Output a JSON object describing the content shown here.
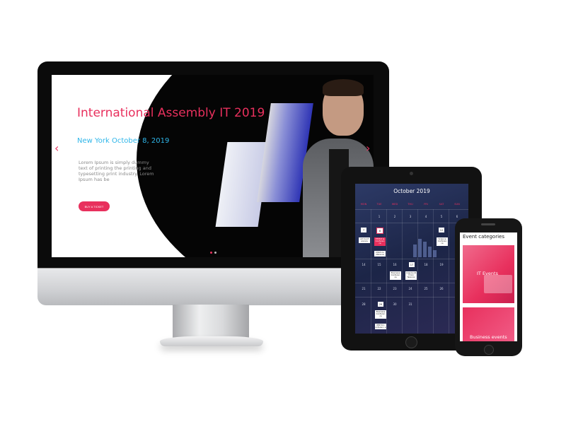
{
  "desktop": {
    "hero": {
      "title": "International Assembly IT 2019",
      "subtitle": "New York October 8, 2019",
      "body": "Lorem Ipsum is simply dummy text of printing the printing and typesetting print industry. Lorem Ipsum has be",
      "button_label": "BUY A TICKET",
      "prev_arrow": "‹",
      "next_arrow": "›"
    }
  },
  "tablet": {
    "calendar": {
      "title": "October 2019",
      "weekdays": [
        "MON",
        "TUE",
        "WED",
        "THU",
        "FRI",
        "SAT",
        "SUN"
      ],
      "week1": [
        "1",
        "2",
        "3",
        "4",
        "5",
        "6"
      ],
      "week2_badges": [
        "7",
        "8",
        "12"
      ],
      "week2_events": [
        "Art Conf erence",
        "HTML5 & Conferen ce",
        "Science Conferen ce"
      ],
      "week2_event_extra": "CSS3 Co nference",
      "week3": [
        "14",
        "15",
        "16",
        "17",
        "18",
        "19",
        "20"
      ],
      "week3_events": [
        "Business Conferen ce",
        "Angula rJS 3 Con ference"
      ],
      "week4": [
        "21",
        "22",
        "23",
        "24",
        "25",
        "26",
        "27"
      ],
      "week5": [
        "28",
        "29",
        "30",
        "31"
      ],
      "week5_events": [
        "Business Conferen ce",
        "PHP 8 C onferenc e"
      ]
    }
  },
  "phone": {
    "heading": "Event categories",
    "categories": [
      "IT Events",
      "Business events"
    ]
  },
  "colors": {
    "accent": "#e8305d",
    "subtitle": "#2fb6e9",
    "calendar_bg": "#1c2547"
  }
}
